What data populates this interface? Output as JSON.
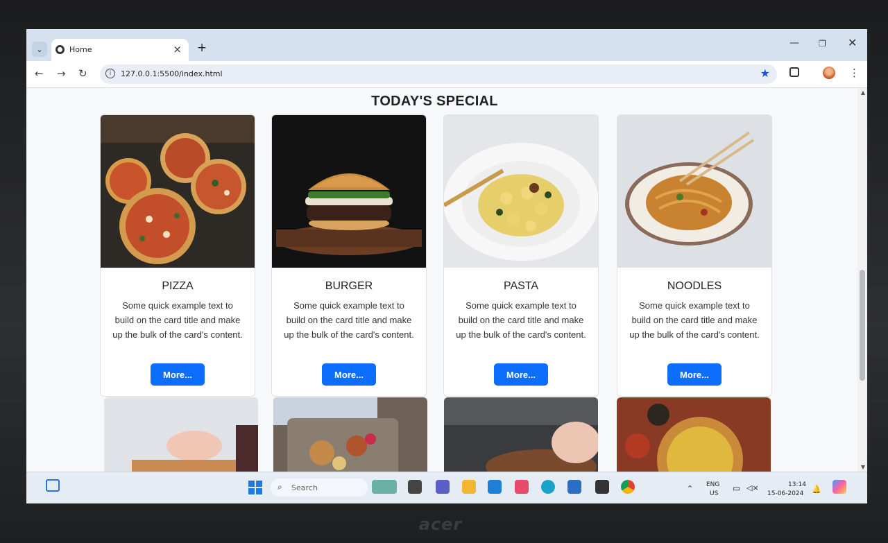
{
  "browser": {
    "tab_title": "Home",
    "url": "127.0.0.1:5500/index.html"
  },
  "page": {
    "heading": "TODAY'S SPECIAL",
    "cards": [
      {
        "title": "PIZZA",
        "text": "Some quick example text to build on the card title and make up the bulk of the card's content.",
        "button": "More..."
      },
      {
        "title": "BURGER",
        "text": "Some quick example text to build on the card title and make up the bulk of the card's content.",
        "button": "More..."
      },
      {
        "title": "PASTA",
        "text": "Some quick example text to build on the card title and make up the bulk of the card's content.",
        "button": "More..."
      },
      {
        "title": "NOODLES",
        "text": "Some quick example text to build on the card title and make up the bulk of the card's content.",
        "button": "More..."
      }
    ],
    "accent_color": "#0d6efd"
  },
  "taskbar": {
    "search_placeholder": "Search",
    "language": "ENG",
    "region": "US",
    "time": "13:14",
    "date": "15-06-2024"
  },
  "bezel_brand": "acer"
}
